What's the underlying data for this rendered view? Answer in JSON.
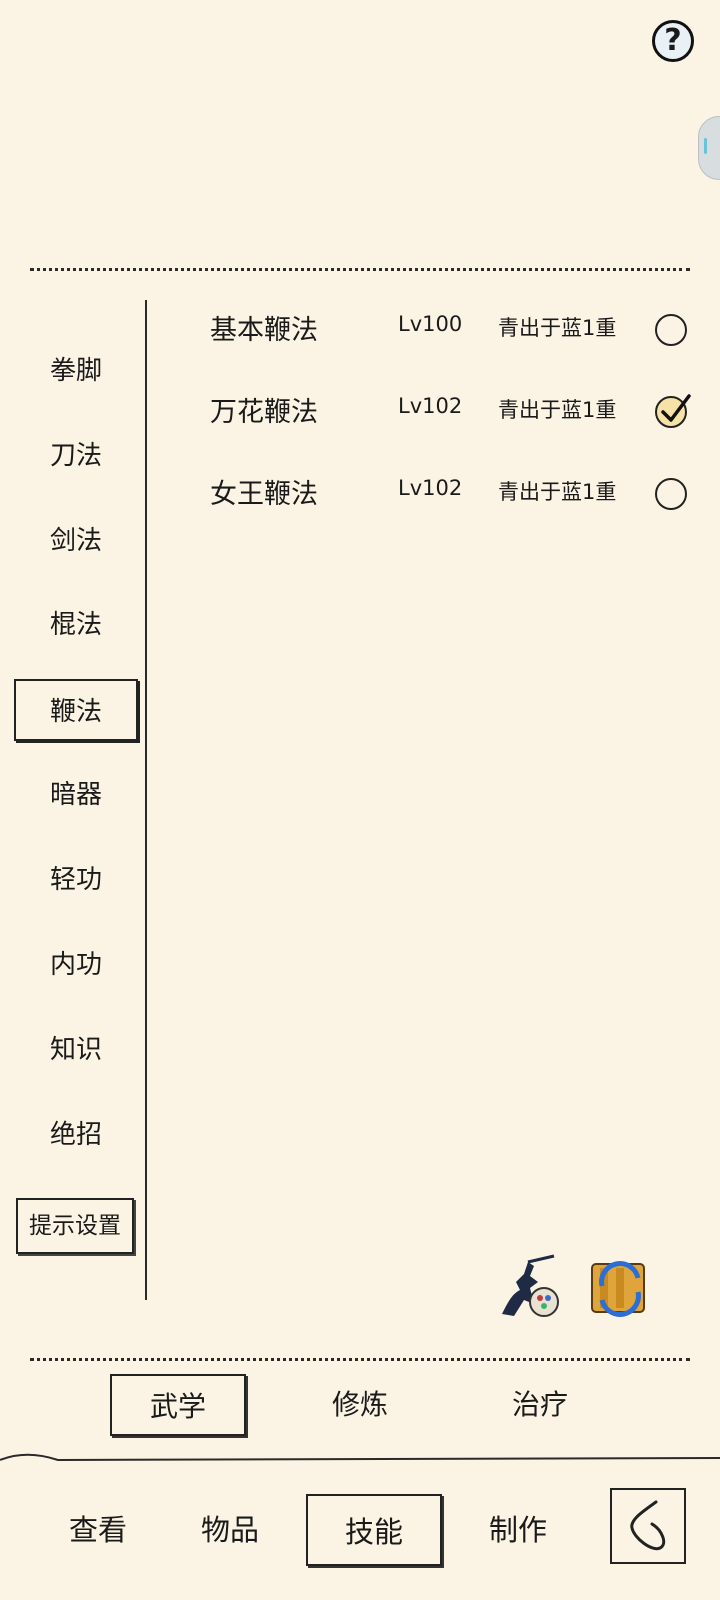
{
  "header": {
    "help_label": "?"
  },
  "categories": [
    {
      "label": "拳脚"
    },
    {
      "label": "刀法"
    },
    {
      "label": "剑法"
    },
    {
      "label": "棍法"
    },
    {
      "label": "鞭法",
      "selected": true
    },
    {
      "label": "暗器"
    },
    {
      "label": "轻功"
    },
    {
      "label": "内功"
    },
    {
      "label": "知识"
    },
    {
      "label": "绝招"
    }
  ],
  "settings_label": "提示设置",
  "skills": [
    {
      "name": "基本鞭法",
      "level": "Lv100",
      "tier": "青出于蓝1重",
      "checked": false
    },
    {
      "name": "万花鞭法",
      "level": "Lv102",
      "tier": "青出于蓝1重",
      "checked": true
    },
    {
      "name": "女王鞭法",
      "level": "Lv102",
      "tier": "青出于蓝1重",
      "checked": false
    }
  ],
  "action_icons": [
    "warrior-paint-icon",
    "scroll-swap-icon"
  ],
  "subtabs": [
    {
      "label": "武学",
      "active": true
    },
    {
      "label": "修炼"
    },
    {
      "label": "治疗"
    }
  ],
  "bottom_nav": [
    {
      "label": "查看"
    },
    {
      "label": "物品"
    },
    {
      "label": "技能",
      "active": true
    },
    {
      "label": "制作"
    }
  ],
  "back_icon": "back-arrow-icon"
}
